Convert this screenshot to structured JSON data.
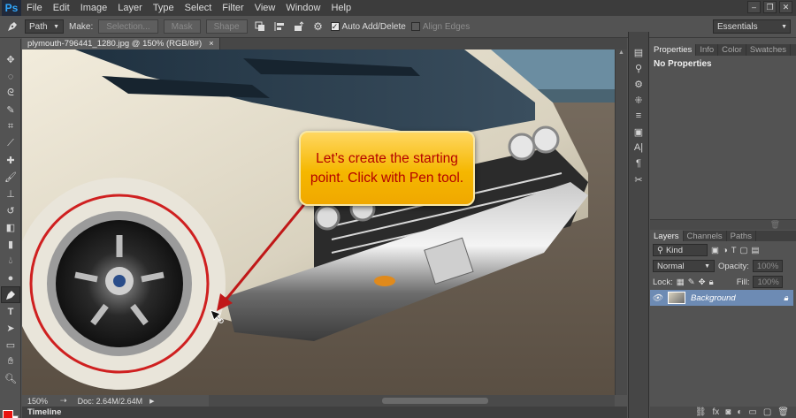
{
  "app": {
    "logo": "Ps"
  },
  "menu": [
    "File",
    "Edit",
    "Image",
    "Layer",
    "Type",
    "Select",
    "Filter",
    "View",
    "Window",
    "Help"
  ],
  "window_controls": [
    "–",
    "❐",
    "✕"
  ],
  "options_bar": {
    "mode_select": "Path",
    "make_label": "Make:",
    "selection_button": "Selection...",
    "mask_button": "Mask",
    "shape_button": "Shape",
    "auto_add_delete": "Auto Add/Delete",
    "auto_add_delete_checked": true,
    "align_edges": "Align Edges",
    "align_edges_checked": false,
    "workspace": "Essentials"
  },
  "document": {
    "tab_title": "plymouth-796441_1280.jpg @ 150% (RGB/8#)",
    "tab_close": "×",
    "zoom": "150%",
    "doc_info": "Doc: 2.64M/2.64M",
    "timeline_label": "Timeline"
  },
  "callout": {
    "text": "Let’s create the starting point. Click with Pen tool."
  },
  "colors": {
    "foreground": "#e8120f",
    "background": "#ffffff",
    "accent_layer": "#6d8bb4",
    "callout": "#f5b700",
    "callout_text": "#b40000"
  },
  "properties_panel": {
    "tabs": [
      "Properties",
      "Info",
      "Color",
      "Swatches"
    ],
    "active_tab": "Properties",
    "content": "No Properties"
  },
  "layers_panel": {
    "tabs": [
      "Layers",
      "Channels",
      "Paths"
    ],
    "active_tab": "Layers",
    "filter_kind": "Kind",
    "blend_mode": "Normal",
    "opacity_label": "Opacity:",
    "opacity_value": "100%",
    "lock_label": "Lock:",
    "fill_label": "Fill:",
    "fill_value": "100%",
    "layers": [
      {
        "name": "Background",
        "locked": true,
        "visible": true
      }
    ]
  }
}
